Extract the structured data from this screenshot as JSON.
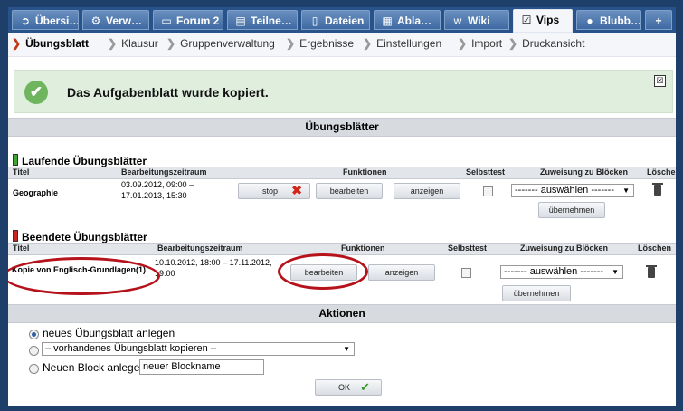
{
  "tabs": [
    {
      "label": "Übersi…",
      "icon": "refresh-icon",
      "glyph": "➲"
    },
    {
      "label": "Verw…",
      "icon": "gears-icon",
      "glyph": "⚙"
    },
    {
      "label": "Forum 2",
      "icon": "speech-bubble-icon",
      "glyph": "💬"
    },
    {
      "label": "Teilne…",
      "icon": "person-icon",
      "glyph": "▤"
    },
    {
      "label": "Dateien",
      "icon": "file-icon",
      "glyph": "▯"
    },
    {
      "label": "Abla…",
      "icon": "calendar-icon",
      "glyph": "▦"
    },
    {
      "label": "Wiki",
      "icon": "wiki-icon",
      "glyph": "w"
    },
    {
      "label": "Vips",
      "icon": "checkbox-icon",
      "glyph": "☑"
    },
    {
      "label": "Blubb…",
      "icon": "bubbles-icon",
      "glyph": "●"
    },
    {
      "label": "+",
      "icon": "",
      "glyph": ""
    }
  ],
  "subnav": [
    "Übungsblatt",
    "Klausur",
    "Gruppenverwaltung",
    "Ergebnisse",
    "Einstellungen",
    "Import",
    "Druckansicht"
  ],
  "message": {
    "text": "Das Aufgabenblatt wurde kopiert.",
    "close": "☒"
  },
  "section_title": "Übungsblätter",
  "running": {
    "heading": "Laufende Übungsblätter",
    "headers": {
      "title": "Titel",
      "period": "Bearbeitungszeitraum",
      "functions": "Funktionen",
      "selftest": "Selbsttest",
      "assign": "Zuweisung zu Blöcken",
      "delete": "Löschen"
    },
    "row": {
      "title": "Geographie",
      "period_1": "03.09.2012, 09:00 –",
      "period_2": "17.01.2013, 15:30",
      "stop": "stop",
      "edit": "bearbeiten",
      "show": "anzeigen",
      "select": "------- auswählen -------",
      "apply": "übernehmen"
    }
  },
  "ended": {
    "heading": "Beendete Übungsblätter",
    "headers": {
      "title": "Titel",
      "period": "Bearbeitungszeitraum",
      "functions": "Funktionen",
      "selftest": "Selbsttest",
      "assign": "Zuweisung zu Blöcken",
      "delete": "Löschen"
    },
    "row": {
      "title": "Kopie von Englisch-Grundlagen(1)",
      "period_1": "10.10.2012, 18:00 – 17.11.2012,",
      "period_2": "19:00",
      "edit": "bearbeiten",
      "show": "anzeigen",
      "select": "------- auswählen -------",
      "apply": "übernehmen"
    }
  },
  "actions": {
    "title": "Aktionen",
    "new_sheet": "neues Übungsblatt anlegen",
    "copy_select": "– vorhandenes Übungsblatt kopieren –",
    "new_block_label": "Neuen Block anlegen:",
    "new_block_value": "neuer Blockname",
    "ok": "OK",
    "ok_icon": "✔"
  },
  "colors": {
    "highlight": "#b5121b",
    "tabbar": "#28538a",
    "success": "#6fb55e"
  }
}
